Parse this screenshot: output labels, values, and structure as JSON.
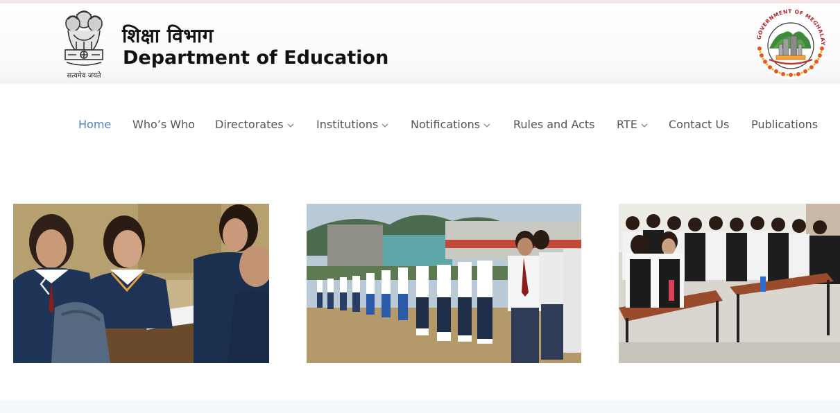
{
  "header": {
    "emblem_motto": "सत्यमेव जयते",
    "hindi_title": "शिक्षा विभाग",
    "title": "Department of Education",
    "logo_ring_text": "GOVERNMENT OF MEGHALAYA"
  },
  "nav": {
    "items": [
      {
        "label": "Home",
        "active": true,
        "dropdown": false
      },
      {
        "label": "Who’s Who",
        "active": false,
        "dropdown": false
      },
      {
        "label": "Directorates",
        "active": false,
        "dropdown": true
      },
      {
        "label": "Institutions",
        "active": false,
        "dropdown": true
      },
      {
        "label": "Notifications",
        "active": false,
        "dropdown": true
      },
      {
        "label": "Rules and Acts",
        "active": false,
        "dropdown": false
      },
      {
        "label": "RTE",
        "active": false,
        "dropdown": true
      },
      {
        "label": "Contact Us",
        "active": false,
        "dropdown": false
      },
      {
        "label": "Publications",
        "active": false,
        "dropdown": false
      }
    ]
  },
  "carousel": {
    "slides": [
      {
        "description_icon": "classroom-students-photo"
      },
      {
        "description_icon": "school-assembly-photo"
      },
      {
        "description_icon": "students-cheering-photo"
      }
    ],
    "prev_icon": "chevron-left-icon"
  },
  "colors": {
    "nav_active": "#4b86c4",
    "nav_text": "#555555",
    "title_text": "#111111"
  }
}
